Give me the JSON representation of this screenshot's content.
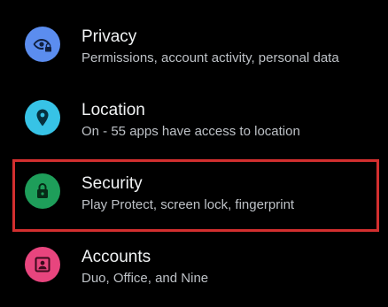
{
  "settings": {
    "items": [
      {
        "title": "Privacy",
        "subtitle": "Permissions, account activity, personal data",
        "icon": "privacy-eye-lock-icon",
        "color": "#5b8def"
      },
      {
        "title": "Location",
        "subtitle": "On - 55 apps have access to location",
        "icon": "location-pin-icon",
        "color": "#37c3e6"
      },
      {
        "title": "Security",
        "subtitle": "Play Protect, screen lock, fingerprint",
        "icon": "lock-icon",
        "color": "#1e9e5a"
      },
      {
        "title": "Accounts",
        "subtitle": "Duo, Office, and Nine",
        "icon": "account-box-icon",
        "color": "#e8457e"
      }
    ]
  },
  "highlight": {
    "target": "Security",
    "color": "#d32f2f"
  }
}
